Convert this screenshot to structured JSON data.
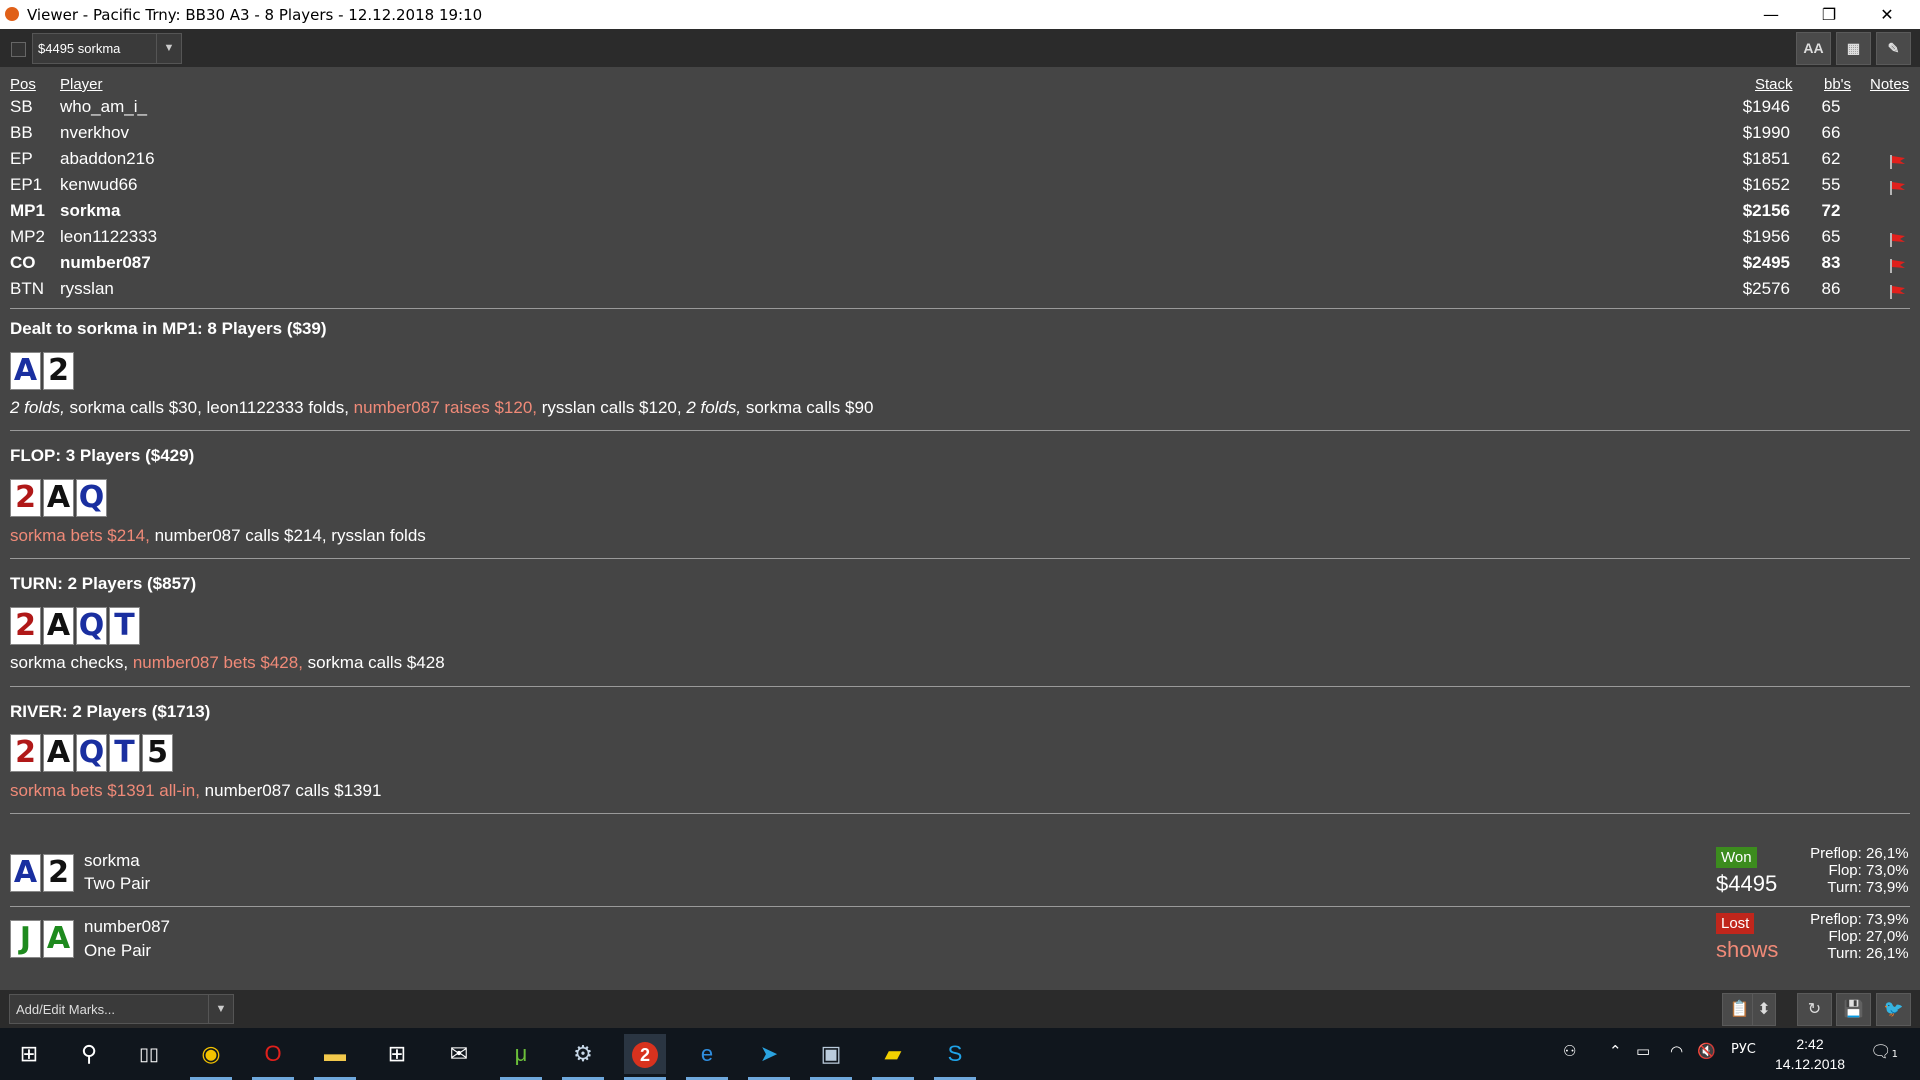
{
  "window": {
    "title": "Viewer - Pacific Trny: BB30 A3 - 8 Players - 12.12.2018 19:10",
    "minimize": "—",
    "restore": "❐",
    "close": "✕"
  },
  "toolbar": {
    "hand_select_value": "$4495 sorkma",
    "font_button": "AA",
    "grid_button": "▦",
    "edit_button": "✎"
  },
  "table": {
    "headers": {
      "pos": "Pos",
      "player": "Player",
      "stack": "Stack",
      "bbs": "bb's",
      "notes": "Notes"
    },
    "rows": [
      {
        "pos": "SB",
        "player": "who_am_i_",
        "stack": "$1946",
        "bbs": "65",
        "note_flag": false,
        "bold": false
      },
      {
        "pos": "BB",
        "player": "nverkhov",
        "stack": "$1990",
        "bbs": "66",
        "note_flag": false,
        "bold": false
      },
      {
        "pos": "EP",
        "player": "abaddon216",
        "stack": "$1851",
        "bbs": "62",
        "note_flag": true,
        "bold": false
      },
      {
        "pos": "EP1",
        "player": "kenwud66",
        "stack": "$1652",
        "bbs": "55",
        "note_flag": true,
        "bold": false
      },
      {
        "pos": "MP1",
        "player": "sorkma",
        "stack": "$2156",
        "bbs": "72",
        "note_flag": false,
        "bold": true
      },
      {
        "pos": "MP2",
        "player": "leon1122333",
        "stack": "$1956",
        "bbs": "65",
        "note_flag": true,
        "bold": false
      },
      {
        "pos": "CO",
        "player": "number087",
        "stack": "$2495",
        "bbs": "83",
        "note_flag": true,
        "bold": true
      },
      {
        "pos": "BTN",
        "player": "rysslan",
        "stack": "$2576",
        "bbs": "86",
        "note_flag": true,
        "bold": false
      }
    ]
  },
  "streets": {
    "preflop": {
      "title": "Dealt to sorkma in MP1: 8 Players ($39)",
      "cards": [
        {
          "rank": "A",
          "suit_color": "#1a2fa0"
        },
        {
          "rank": "2",
          "suit_color": "#111111"
        }
      ],
      "actions": [
        {
          "text": "2 folds,",
          "style": "italic"
        },
        {
          "text": " sorkma calls $30, leon1122333 folds, ",
          "style": "white"
        },
        {
          "text": "number087 raises $120,",
          "style": "red"
        },
        {
          "text": " rysslan calls $120, ",
          "style": "white"
        },
        {
          "text": "2 folds,",
          "style": "italic"
        },
        {
          "text": " sorkma calls $90",
          "style": "white"
        }
      ]
    },
    "flop": {
      "title": "FLOP: 3 Players ($429)",
      "cards": [
        {
          "rank": "2",
          "suit_color": "#b01818"
        },
        {
          "rank": "A",
          "suit_color": "#111111"
        },
        {
          "rank": "Q",
          "suit_color": "#1a2fa0"
        }
      ],
      "actions": [
        {
          "text": "sorkma bets $214,",
          "style": "red"
        },
        {
          "text": " number087 calls $214, rysslan folds",
          "style": "white"
        }
      ]
    },
    "turn": {
      "title": "TURN: 2 Players ($857)",
      "cards": [
        {
          "rank": "2",
          "suit_color": "#b01818"
        },
        {
          "rank": "A",
          "suit_color": "#111111"
        },
        {
          "rank": "Q",
          "suit_color": "#1a2fa0"
        },
        {
          "rank": "T",
          "suit_color": "#1a2fa0"
        }
      ],
      "actions": [
        {
          "text": "sorkma checks, ",
          "style": "white"
        },
        {
          "text": "number087 bets $428,",
          "style": "red"
        },
        {
          "text": " sorkma calls $428",
          "style": "white"
        }
      ]
    },
    "river": {
      "title": "RIVER: 2 Players ($1713)",
      "cards": [
        {
          "rank": "2",
          "suit_color": "#b01818"
        },
        {
          "rank": "A",
          "suit_color": "#111111"
        },
        {
          "rank": "Q",
          "suit_color": "#1a2fa0"
        },
        {
          "rank": "T",
          "suit_color": "#1a2fa0"
        },
        {
          "rank": "5",
          "suit_color": "#111111"
        }
      ],
      "actions": [
        {
          "text": "sorkma bets $1391 all-in,",
          "style": "red"
        },
        {
          "text": " number087 calls $1391",
          "style": "white"
        }
      ]
    }
  },
  "results": [
    {
      "cards": [
        {
          "rank": "A",
          "suit_color": "#1a2fa0"
        },
        {
          "rank": "2",
          "suit_color": "#111111"
        }
      ],
      "player": "sorkma",
      "hand": "Two Pair",
      "badge": "Won",
      "badge_color": "#3c8c1e",
      "amount": "$4495",
      "amount_color": "#ffffff",
      "equity": [
        {
          "label": "Preflop:",
          "value": "26,1%"
        },
        {
          "label": "Flop:",
          "value": "73,0%"
        },
        {
          "label": "Turn:",
          "value": "73,9%"
        }
      ]
    },
    {
      "cards": [
        {
          "rank": "J",
          "suit_color": "#1e8a1e"
        },
        {
          "rank": "A",
          "suit_color": "#1e8a1e"
        }
      ],
      "player": "number087",
      "hand": "One Pair",
      "badge": "Lost",
      "badge_color": "#c0261c",
      "amount": "shows",
      "amount_color": "#f08a78",
      "equity": [
        {
          "label": "Preflop:",
          "value": "73,9%"
        },
        {
          "label": "Flop:",
          "value": "27,0%"
        },
        {
          "label": "Turn:",
          "value": "26,1%"
        }
      ]
    }
  ],
  "bottombar": {
    "marks_select_value": "Add/Edit Marks...",
    "clipboard_icon": "📋",
    "updown_icon": "⬍",
    "refresh_icon": "↻",
    "save_icon": "💾",
    "twitter_icon": "🐦"
  },
  "taskbar": {
    "tray_lang": "РУС",
    "time": "2:42",
    "date": "14.12.2018",
    "notification_count": "1"
  }
}
